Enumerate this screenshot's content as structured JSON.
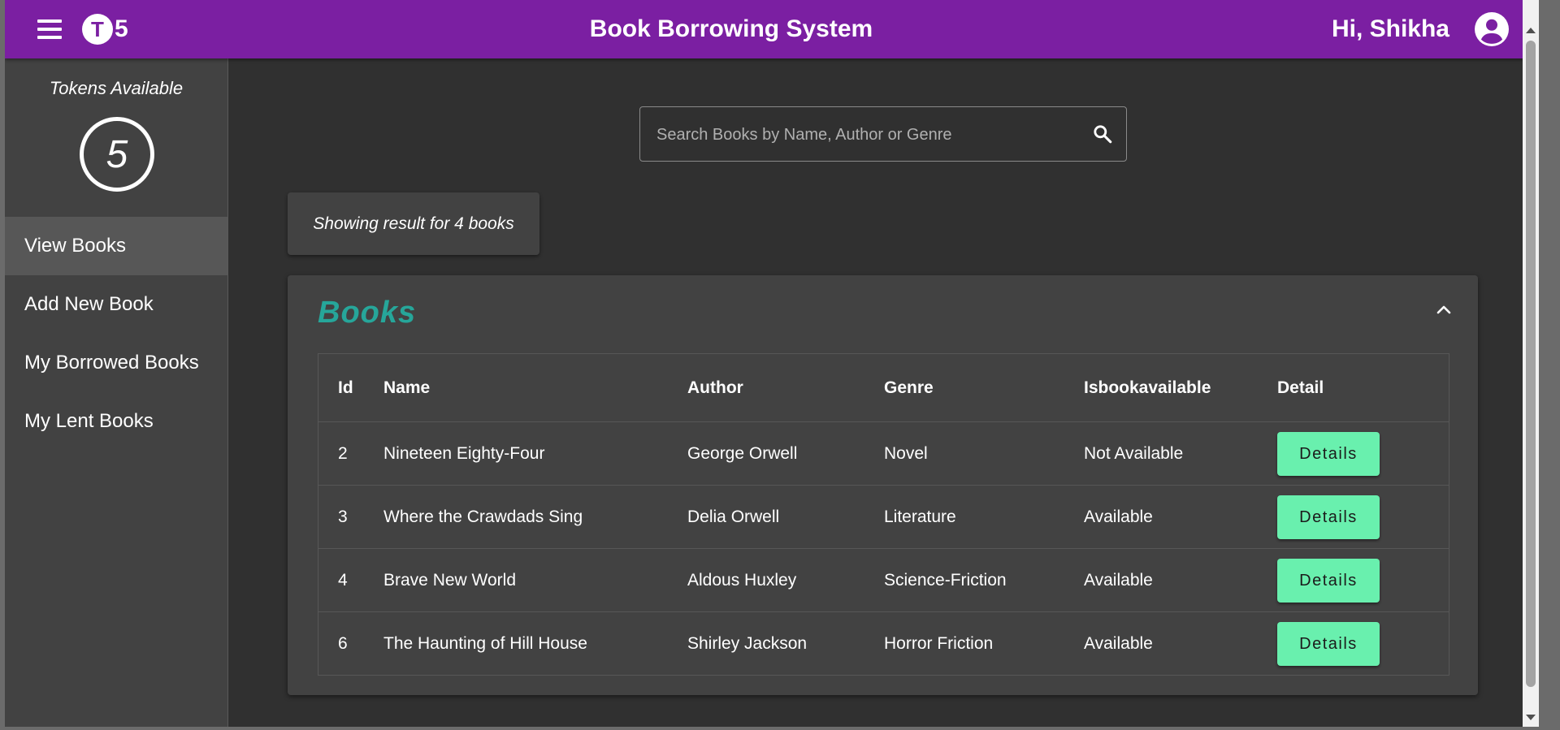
{
  "header": {
    "logo_letter": "T",
    "logo_digit": "5",
    "title": "Book Borrowing System",
    "greeting": "Hi, Shikha",
    "bar_color": "#7b1fa2"
  },
  "sidebar": {
    "tokens_label": "Tokens Available",
    "tokens_count": "5",
    "items": [
      {
        "label": "View Books",
        "active": true
      },
      {
        "label": "Add New Book",
        "active": false
      },
      {
        "label": "My Borrowed Books",
        "active": false
      },
      {
        "label": "My Lent Books",
        "active": false
      }
    ]
  },
  "search": {
    "placeholder": "Search Books by Name, Author or Genre",
    "value": ""
  },
  "result_text": "Showing result for 4 books",
  "books_panel": {
    "title": "Books",
    "title_color": "#26a69a",
    "columns": [
      "Id",
      "Name",
      "Author",
      "Genre",
      "Isbookavailable",
      "Detail"
    ],
    "rows": [
      {
        "id": "2",
        "name": "Nineteen Eighty-Four",
        "author": "George Orwell",
        "genre": "Novel",
        "available": "Not Available",
        "action": "Details"
      },
      {
        "id": "3",
        "name": "Where the Crawdads Sing",
        "author": "Delia Orwell",
        "genre": "Literature",
        "available": "Available",
        "action": "Details"
      },
      {
        "id": "4",
        "name": "Brave New World",
        "author": "Aldous Huxley",
        "genre": "Science-Friction",
        "available": "Available",
        "action": "Details"
      },
      {
        "id": "6",
        "name": "The Haunting of Hill House",
        "author": "Shirley Jackson",
        "genre": "Horror Friction",
        "available": "Available",
        "action": "Details"
      }
    ],
    "button_color": "#69f0ae"
  },
  "icons": {
    "menu": "menu-icon",
    "account": "account-circle-icon",
    "search": "search-icon",
    "collapse": "chevron-up-icon"
  }
}
